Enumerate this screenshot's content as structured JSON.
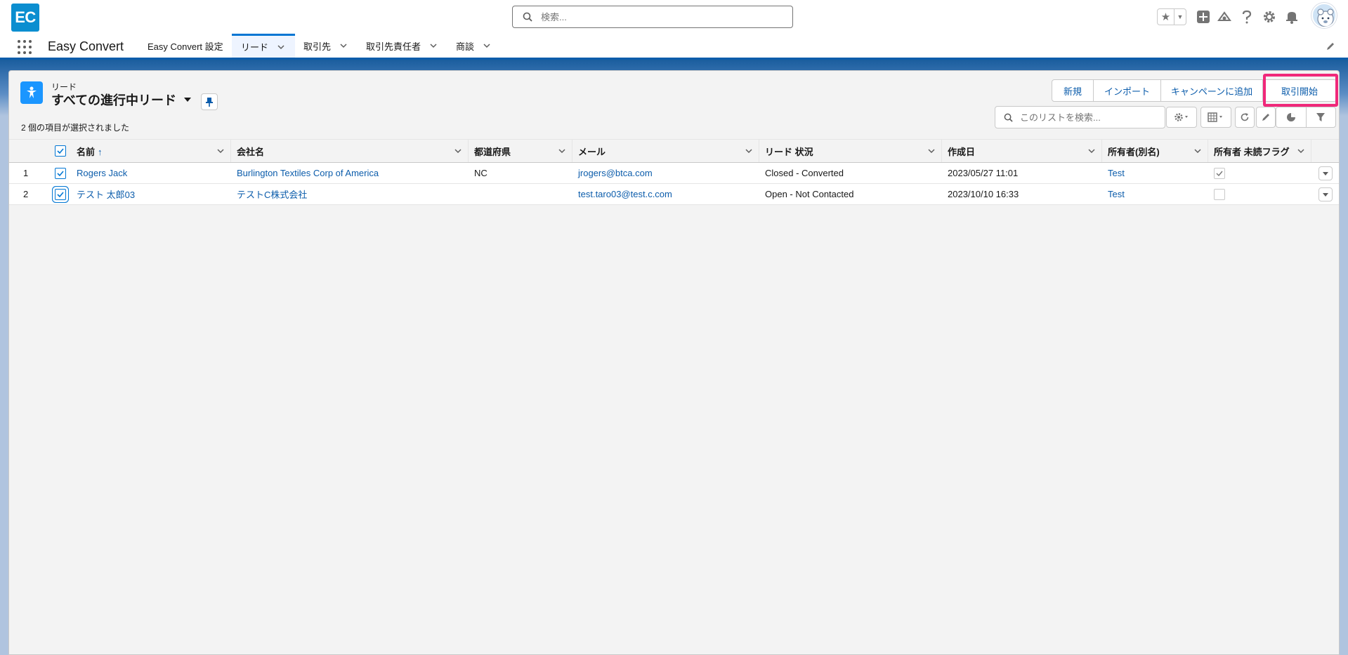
{
  "header": {
    "logo_text": "EC",
    "search_placeholder": "検索...",
    "icons": [
      "favorites-star-icon",
      "favorites-dropdown-icon",
      "global-add-icon",
      "trailhead-icon",
      "help-icon",
      "setup-gear-icon",
      "notifications-bell-icon",
      "user-avatar"
    ]
  },
  "nav": {
    "app_name": "Easy Convert",
    "items": [
      {
        "label": "Easy Convert 設定",
        "has_menu": false,
        "active": false
      },
      {
        "label": "リード",
        "has_menu": true,
        "active": true
      },
      {
        "label": "取引先",
        "has_menu": true,
        "active": false
      },
      {
        "label": "取引先責任者",
        "has_menu": true,
        "active": false
      },
      {
        "label": "商談",
        "has_menu": true,
        "active": false
      }
    ]
  },
  "list": {
    "object_label": "リード",
    "view_title": "すべての進行中リード",
    "selected_text": "2 個の項目が選択されました",
    "buttons": {
      "new": "新規",
      "import": "インポート",
      "add_to_campaign": "キャンペーンに追加",
      "start_deal": "取引開始"
    },
    "search_placeholder": "このリストを検索...",
    "columns": [
      "名前",
      "会社名",
      "都道府県",
      "メール",
      "リード 状況",
      "作成日",
      "所有者(別名)",
      "所有者 未読フラグ"
    ],
    "sort_indicator": "↑",
    "rows": [
      {
        "num": "1",
        "selected": true,
        "name": "Rogers Jack",
        "company": "Burlington Textiles Corp of America",
        "state": "NC",
        "email": "jrogers@btca.com",
        "status": "Closed - Converted",
        "created": "2023/05/27 11:01",
        "owner": "Test",
        "unread": true
      },
      {
        "num": "2",
        "selected": true,
        "name": "テスト 太郎03",
        "company": "テストC株式会社",
        "state": "",
        "email": "test.taro03@test.c.com",
        "status": "Open - Not Contacted",
        "created": "2023/10/10 16:33",
        "owner": "Test",
        "unread": false
      }
    ]
  },
  "colors": {
    "brand": "#0b8ed0",
    "link": "#0b5cab",
    "highlight": "#f0287a",
    "lead_icon": "#1b96ff"
  }
}
